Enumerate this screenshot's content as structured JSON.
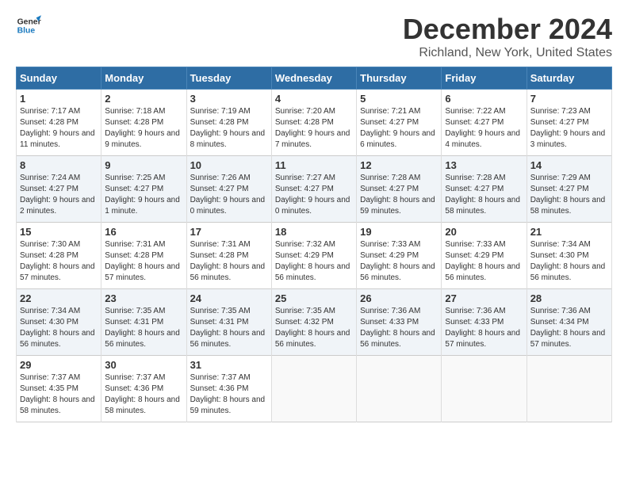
{
  "logo": {
    "line1": "General",
    "line2": "Blue"
  },
  "title": "December 2024",
  "subtitle": "Richland, New York, United States",
  "days_of_week": [
    "Sunday",
    "Monday",
    "Tuesday",
    "Wednesday",
    "Thursday",
    "Friday",
    "Saturday"
  ],
  "weeks": [
    [
      {
        "day": "1",
        "sunrise": "7:17 AM",
        "sunset": "4:28 PM",
        "daylight": "9 hours and 11 minutes."
      },
      {
        "day": "2",
        "sunrise": "7:18 AM",
        "sunset": "4:28 PM",
        "daylight": "9 hours and 9 minutes."
      },
      {
        "day": "3",
        "sunrise": "7:19 AM",
        "sunset": "4:28 PM",
        "daylight": "9 hours and 8 minutes."
      },
      {
        "day": "4",
        "sunrise": "7:20 AM",
        "sunset": "4:28 PM",
        "daylight": "9 hours and 7 minutes."
      },
      {
        "day": "5",
        "sunrise": "7:21 AM",
        "sunset": "4:27 PM",
        "daylight": "9 hours and 6 minutes."
      },
      {
        "day": "6",
        "sunrise": "7:22 AM",
        "sunset": "4:27 PM",
        "daylight": "9 hours and 4 minutes."
      },
      {
        "day": "7",
        "sunrise": "7:23 AM",
        "sunset": "4:27 PM",
        "daylight": "9 hours and 3 minutes."
      }
    ],
    [
      {
        "day": "8",
        "sunrise": "7:24 AM",
        "sunset": "4:27 PM",
        "daylight": "9 hours and 2 minutes."
      },
      {
        "day": "9",
        "sunrise": "7:25 AM",
        "sunset": "4:27 PM",
        "daylight": "9 hours and 1 minute."
      },
      {
        "day": "10",
        "sunrise": "7:26 AM",
        "sunset": "4:27 PM",
        "daylight": "9 hours and 0 minutes."
      },
      {
        "day": "11",
        "sunrise": "7:27 AM",
        "sunset": "4:27 PM",
        "daylight": "9 hours and 0 minutes."
      },
      {
        "day": "12",
        "sunrise": "7:28 AM",
        "sunset": "4:27 PM",
        "daylight": "8 hours and 59 minutes."
      },
      {
        "day": "13",
        "sunrise": "7:28 AM",
        "sunset": "4:27 PM",
        "daylight": "8 hours and 58 minutes."
      },
      {
        "day": "14",
        "sunrise": "7:29 AM",
        "sunset": "4:27 PM",
        "daylight": "8 hours and 58 minutes."
      }
    ],
    [
      {
        "day": "15",
        "sunrise": "7:30 AM",
        "sunset": "4:28 PM",
        "daylight": "8 hours and 57 minutes."
      },
      {
        "day": "16",
        "sunrise": "7:31 AM",
        "sunset": "4:28 PM",
        "daylight": "8 hours and 57 minutes."
      },
      {
        "day": "17",
        "sunrise": "7:31 AM",
        "sunset": "4:28 PM",
        "daylight": "8 hours and 56 minutes."
      },
      {
        "day": "18",
        "sunrise": "7:32 AM",
        "sunset": "4:29 PM",
        "daylight": "8 hours and 56 minutes."
      },
      {
        "day": "19",
        "sunrise": "7:33 AM",
        "sunset": "4:29 PM",
        "daylight": "8 hours and 56 minutes."
      },
      {
        "day": "20",
        "sunrise": "7:33 AM",
        "sunset": "4:29 PM",
        "daylight": "8 hours and 56 minutes."
      },
      {
        "day": "21",
        "sunrise": "7:34 AM",
        "sunset": "4:30 PM",
        "daylight": "8 hours and 56 minutes."
      }
    ],
    [
      {
        "day": "22",
        "sunrise": "7:34 AM",
        "sunset": "4:30 PM",
        "daylight": "8 hours and 56 minutes."
      },
      {
        "day": "23",
        "sunrise": "7:35 AM",
        "sunset": "4:31 PM",
        "daylight": "8 hours and 56 minutes."
      },
      {
        "day": "24",
        "sunrise": "7:35 AM",
        "sunset": "4:31 PM",
        "daylight": "8 hours and 56 minutes."
      },
      {
        "day": "25",
        "sunrise": "7:35 AM",
        "sunset": "4:32 PM",
        "daylight": "8 hours and 56 minutes."
      },
      {
        "day": "26",
        "sunrise": "7:36 AM",
        "sunset": "4:33 PM",
        "daylight": "8 hours and 56 minutes."
      },
      {
        "day": "27",
        "sunrise": "7:36 AM",
        "sunset": "4:33 PM",
        "daylight": "8 hours and 57 minutes."
      },
      {
        "day": "28",
        "sunrise": "7:36 AM",
        "sunset": "4:34 PM",
        "daylight": "8 hours and 57 minutes."
      }
    ],
    [
      {
        "day": "29",
        "sunrise": "7:37 AM",
        "sunset": "4:35 PM",
        "daylight": "8 hours and 58 minutes."
      },
      {
        "day": "30",
        "sunrise": "7:37 AM",
        "sunset": "4:36 PM",
        "daylight": "8 hours and 58 minutes."
      },
      {
        "day": "31",
        "sunrise": "7:37 AM",
        "sunset": "4:36 PM",
        "daylight": "8 hours and 59 minutes."
      },
      null,
      null,
      null,
      null
    ]
  ]
}
